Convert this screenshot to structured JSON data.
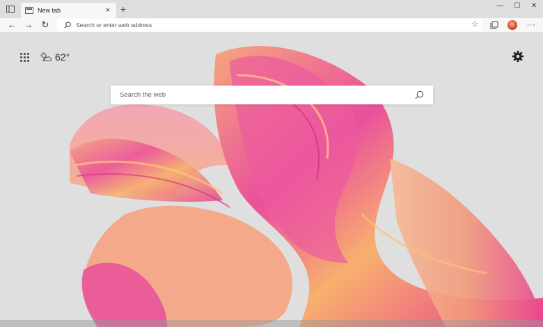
{
  "window": {
    "tab_title": "New tab",
    "tab_close_glyph": "×",
    "new_tab_glyph": "+",
    "minimize_glyph": "—",
    "maximize_glyph": "☐",
    "close_glyph": "✕"
  },
  "toolbar": {
    "back_glyph": "←",
    "forward_glyph": "→",
    "refresh_glyph": "↻",
    "address_placeholder": "Search or enter web address",
    "favorite_glyph": "☆",
    "more_glyph": "···"
  },
  "newtab": {
    "temperature": "62°",
    "search_placeholder": "Search the web"
  },
  "icons": {
    "tab_actions": "tab-actions-icon",
    "favicon": "page-icon",
    "search": "search-icon",
    "collections": "collections-icon",
    "profile": "avatar",
    "apps": "apps-grid-icon",
    "weather": "cloud-sun-icon",
    "settings": "gear-icon"
  },
  "colors": {
    "titlebar": "#dedede",
    "toolbar": "#f7f7f7",
    "page_background": "#e0dfe0",
    "art_primary": "#e94b9a",
    "art_secondary": "#f4a06b"
  }
}
